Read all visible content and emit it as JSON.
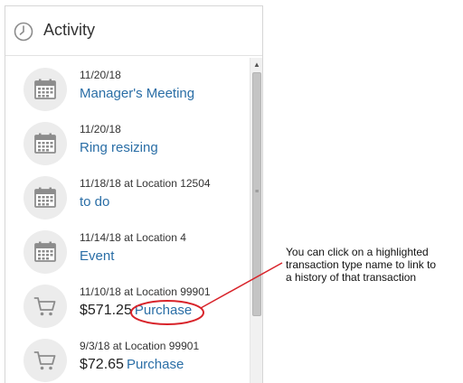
{
  "header": {
    "title": "Activity",
    "icon": "clock-icon"
  },
  "items": [
    {
      "type": "event",
      "icon": "calendar-icon",
      "meta": "11/20/18",
      "amount": "",
      "label": "Manager's Meeting"
    },
    {
      "type": "event",
      "icon": "calendar-icon",
      "meta": "11/20/18",
      "amount": "",
      "label": "Ring resizing"
    },
    {
      "type": "event",
      "icon": "calendar-icon",
      "meta": "11/18/18 at Location 12504",
      "amount": "",
      "label": "to do"
    },
    {
      "type": "event",
      "icon": "calendar-icon",
      "meta": "11/14/18 at Location 4",
      "amount": "",
      "label": "Event"
    },
    {
      "type": "purchase",
      "icon": "shopping-cart-icon",
      "meta": "11/10/18 at Location 99901",
      "amount": "$571.25",
      "label": "Purchase"
    },
    {
      "type": "purchase",
      "icon": "shopping-cart-icon",
      "meta": "9/3/18 at Location 99901",
      "amount": "$72.65",
      "label": "Purchase"
    }
  ],
  "callout": {
    "text": "You can click on a highlighted\ntransaction type name to link to\na history of that transaction",
    "color": "#d8232a"
  },
  "colors": {
    "link": "#2a6ea6",
    "icon_bg": "#ececec",
    "icon_fg": "#8c8c8c"
  }
}
